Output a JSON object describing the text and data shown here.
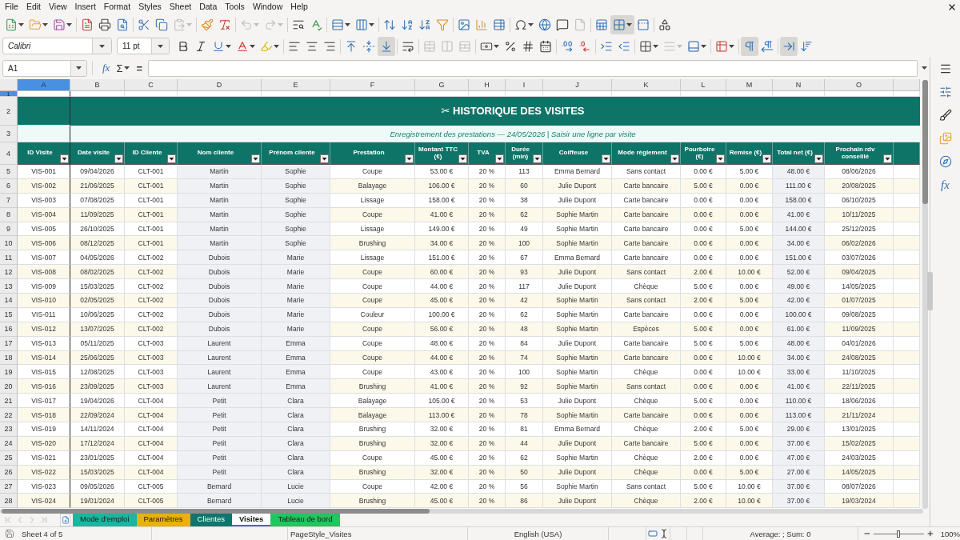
{
  "menu": [
    "File",
    "Edit",
    "View",
    "Insert",
    "Format",
    "Styles",
    "Sheet",
    "Data",
    "Tools",
    "Window",
    "Help"
  ],
  "toolbars": {
    "standard": [
      {
        "dropdown": true,
        "pressed": false,
        "disabled": false
      },
      {
        "dropdown": true,
        "pressed": false,
        "disabled": false
      },
      {
        "dropdown": true,
        "pressed": false,
        "disabled": false
      },
      {
        "dropdown": false,
        "pressed": false,
        "disabled": false
      },
      {
        "dropdown": false,
        "pressed": false,
        "disabled": false
      },
      {
        "dropdown": false,
        "pressed": false,
        "disabled": false
      },
      {
        "dropdown": false,
        "pressed": false,
        "disabled": false
      },
      {
        "dropdown": false,
        "pressed": false,
        "disabled": false
      },
      {
        "dropdown": true,
        "pressed": false,
        "disabled": true
      },
      {
        "dropdown": false,
        "pressed": false,
        "disabled": false
      },
      {
        "dropdown": false,
        "pressed": false,
        "disabled": false
      },
      {
        "dropdown": true,
        "pressed": false,
        "disabled": true
      },
      {
        "dropdown": true,
        "pressed": false,
        "disabled": true
      },
      {
        "dropdown": false,
        "pressed": false,
        "disabled": false
      },
      {
        "dropdown": false,
        "pressed": false,
        "disabled": false
      },
      {
        "dropdown": true,
        "pressed": false,
        "disabled": false
      },
      {
        "dropdown": true,
        "pressed": false,
        "disabled": false
      },
      {
        "dropdown": false,
        "pressed": false,
        "disabled": false
      },
      {
        "dropdown": false,
        "pressed": false,
        "disabled": false
      },
      {
        "dropdown": false,
        "pressed": false,
        "disabled": false
      },
      {
        "dropdown": false,
        "pressed": false,
        "disabled": false
      },
      {
        "dropdown": false,
        "pressed": false,
        "disabled": false
      },
      {
        "dropdown": false,
        "pressed": false,
        "disabled": false
      },
      {
        "dropdown": false,
        "pressed": false,
        "disabled": false
      },
      {
        "dropdown": true,
        "pressed": false,
        "disabled": false
      },
      {
        "dropdown": false,
        "pressed": false,
        "disabled": false
      },
      {
        "dropdown": false,
        "pressed": false,
        "disabled": false
      },
      {
        "dropdown": false,
        "pressed": false,
        "disabled": true
      },
      {
        "dropdown": false,
        "pressed": false,
        "disabled": false
      },
      {
        "dropdown": true,
        "pressed": true,
        "disabled": false
      },
      {
        "dropdown": false,
        "pressed": false,
        "disabled": false
      },
      {
        "dropdown": false,
        "pressed": false,
        "disabled": false
      }
    ],
    "formatting": [
      {
        "dropdown": false,
        "pressed": false,
        "disabled": false
      },
      {
        "dropdown": false,
        "pressed": false,
        "disabled": false
      },
      {
        "dropdown": true,
        "pressed": false,
        "disabled": false
      },
      {
        "dropdown": true,
        "pressed": false,
        "disabled": false
      },
      {
        "dropdown": true,
        "pressed": false,
        "disabled": false
      },
      {
        "dropdown": false,
        "pressed": false,
        "disabled": false
      },
      {
        "dropdown": false,
        "pressed": false,
        "disabled": false
      },
      {
        "dropdown": false,
        "pressed": false,
        "disabled": false
      },
      {
        "dropdown": false,
        "pressed": false,
        "disabled": false
      },
      {
        "dropdown": false,
        "pressed": false,
        "disabled": false
      },
      {
        "dropdown": false,
        "pressed": true,
        "disabled": false
      },
      {
        "dropdown": false,
        "pressed": false,
        "disabled": false
      },
      {
        "dropdown": false,
        "pressed": false,
        "disabled": true
      },
      {
        "dropdown": false,
        "pressed": false,
        "disabled": true
      },
      {
        "dropdown": false,
        "pressed": false,
        "disabled": true
      },
      {
        "dropdown": true,
        "pressed": false,
        "disabled": false
      },
      {
        "dropdown": false,
        "pressed": false,
        "disabled": false
      },
      {
        "dropdown": false,
        "pressed": false,
        "disabled": false
      },
      {
        "dropdown": false,
        "pressed": false,
        "disabled": false
      },
      {
        "dropdown": false,
        "pressed": false,
        "disabled": false
      },
      {
        "dropdown": false,
        "pressed": false,
        "disabled": false
      },
      {
        "dropdown": false,
        "pressed": false,
        "disabled": false
      },
      {
        "dropdown": false,
        "pressed": false,
        "disabled": false
      },
      {
        "dropdown": true,
        "pressed": false,
        "disabled": false
      },
      {
        "dropdown": true,
        "pressed": false,
        "disabled": true
      },
      {
        "dropdown": true,
        "pressed": false,
        "disabled": false
      },
      {
        "dropdown": true,
        "pressed": false,
        "disabled": false
      },
      {
        "dropdown": false,
        "pressed": true,
        "disabled": false
      },
      {
        "dropdown": false,
        "pressed": false,
        "disabled": false
      },
      {
        "dropdown": false,
        "pressed": true,
        "disabled": false
      },
      {
        "dropdown": false,
        "pressed": false,
        "disabled": false
      }
    ]
  },
  "font": {
    "name": "Calibri",
    "size": "11 pt"
  },
  "formula_bar": {
    "name_box": "A1",
    "function_wizard": "fx",
    "sum": "Σ",
    "equals": "="
  },
  "sidebar": {
    "functions": "fx"
  },
  "columns": [
    {
      "label": "A",
      "selected": true
    },
    {
      "label": "B",
      "selected": false
    },
    {
      "label": "C",
      "selected": false
    },
    {
      "label": "D",
      "selected": false
    },
    {
      "label": "E",
      "selected": false
    },
    {
      "label": "F",
      "selected": false
    },
    {
      "label": "G",
      "selected": false
    },
    {
      "label": "H",
      "selected": false
    },
    {
      "label": "I",
      "selected": false
    },
    {
      "label": "J",
      "selected": false
    },
    {
      "label": "K",
      "selected": false
    },
    {
      "label": "L",
      "selected": false
    },
    {
      "label": "M",
      "selected": false
    },
    {
      "label": "N",
      "selected": false
    },
    {
      "label": "O",
      "selected": false
    }
  ],
  "rows": [
    {
      "kind": "blank",
      "number": "1",
      "selected": true
    },
    {
      "kind": "title",
      "number": "2",
      "selected": false,
      "text": "✂ HISTORIQUE DES VISITES"
    },
    {
      "kind": "subtitle",
      "number": "3",
      "selected": false,
      "text": "Enregistrement des prestations — 24/05/2026 | Saisir une ligne par visite"
    },
    {
      "kind": "header",
      "number": "4",
      "selected": false,
      "cells": [
        {
          "label": "ID Visite",
          "kind": "input"
        },
        {
          "label": "Date visite",
          "kind": "input"
        },
        {
          "label": "ID Cliente",
          "kind": "input"
        },
        {
          "label": "Nom cliente",
          "kind": "computed"
        },
        {
          "label": "Prénom cliente",
          "kind": "computed"
        },
        {
          "label": "Prestation",
          "kind": "input"
        },
        {
          "label": "Montant TTC (€)",
          "kind": "input"
        },
        {
          "label": "TVA",
          "kind": "input"
        },
        {
          "label": "Durée (min)",
          "kind": "input"
        },
        {
          "label": "Coiffeuse",
          "kind": "input"
        },
        {
          "label": "Mode règlement",
          "kind": "input"
        },
        {
          "label": "Pourboire (€)",
          "kind": "input"
        },
        {
          "label": "Remise (€)",
          "kind": "input"
        },
        {
          "label": "Total net (€)",
          "kind": "computed"
        },
        {
          "label": "Prochain rdv conseillé",
          "kind": "input"
        }
      ]
    },
    {
      "kind": "data",
      "number": "5",
      "selected": false,
      "cells": [
        "VIS-001",
        "09/04/2026",
        "CLT-001",
        "Martin",
        "Sophie",
        "Coupe",
        "53.00 €",
        "20 %",
        "113",
        "Emma Bernard",
        "Sans contact",
        "0.00 €",
        "5.00 €",
        "48.00 €",
        "08/06/2026"
      ]
    },
    {
      "kind": "data",
      "number": "6",
      "selected": false,
      "cells": [
        "VIS-002",
        "21/06/2025",
        "CLT-001",
        "Martin",
        "Sophie",
        "Balayage",
        "106.00 €",
        "20 %",
        "60",
        "Julie Dupont",
        "Carte bancaire",
        "5.00 €",
        "0.00 €",
        "111.00 €",
        "20/08/2025"
      ]
    },
    {
      "kind": "data",
      "number": "7",
      "selected": false,
      "cells": [
        "VIS-003",
        "07/08/2025",
        "CLT-001",
        "Martin",
        "Sophie",
        "Lissage",
        "158.00 €",
        "20 %",
        "38",
        "Julie Dupont",
        "Carte bancaire",
        "0.00 €",
        "0.00 €",
        "158.00 €",
        "06/10/2025"
      ]
    },
    {
      "kind": "data",
      "number": "8",
      "selected": false,
      "cells": [
        "VIS-004",
        "11/09/2025",
        "CLT-001",
        "Martin",
        "Sophie",
        "Coupe",
        "41.00 €",
        "20 %",
        "62",
        "Sophie Martin",
        "Carte bancaire",
        "0.00 €",
        "0.00 €",
        "41.00 €",
        "10/11/2025"
      ]
    },
    {
      "kind": "data",
      "number": "9",
      "selected": false,
      "cells": [
        "VIS-005",
        "26/10/2025",
        "CLT-001",
        "Martin",
        "Sophie",
        "Lissage",
        "149.00 €",
        "20 %",
        "49",
        "Sophie Martin",
        "Carte bancaire",
        "0.00 €",
        "5.00 €",
        "144.00 €",
        "25/12/2025"
      ]
    },
    {
      "kind": "data",
      "number": "10",
      "selected": false,
      "cells": [
        "VIS-006",
        "08/12/2025",
        "CLT-001",
        "Martin",
        "Sophie",
        "Brushing",
        "34.00 €",
        "20 %",
        "100",
        "Sophie Martin",
        "Carte bancaire",
        "0.00 €",
        "0.00 €",
        "34.00 €",
        "06/02/2026"
      ]
    },
    {
      "kind": "data",
      "number": "11",
      "selected": false,
      "cells": [
        "VIS-007",
        "04/05/2026",
        "CLT-002",
        "Dubois",
        "Marie",
        "Lissage",
        "151.00 €",
        "20 %",
        "67",
        "Emma Bernard",
        "Carte bancaire",
        "0.00 €",
        "0.00 €",
        "151.00 €",
        "03/07/2026"
      ]
    },
    {
      "kind": "data",
      "number": "12",
      "selected": false,
      "cells": [
        "VIS-008",
        "08/02/2025",
        "CLT-002",
        "Dubois",
        "Marie",
        "Coupe",
        "60.00 €",
        "20 %",
        "93",
        "Julie Dupont",
        "Sans contact",
        "2.00 €",
        "10.00 €",
        "52.00 €",
        "09/04/2025"
      ]
    },
    {
      "kind": "data",
      "number": "13",
      "selected": false,
      "cells": [
        "VIS-009",
        "15/03/2025",
        "CLT-002",
        "Dubois",
        "Marie",
        "Coupe",
        "44.00 €",
        "20 %",
        "117",
        "Julie Dupont",
        "Chèque",
        "5.00 €",
        "0.00 €",
        "49.00 €",
        "14/05/2025"
      ]
    },
    {
      "kind": "data",
      "number": "14",
      "selected": false,
      "cells": [
        "VIS-010",
        "02/05/2025",
        "CLT-002",
        "Dubois",
        "Marie",
        "Coupe",
        "45.00 €",
        "20 %",
        "42",
        "Sophie Martin",
        "Sans contact",
        "2.00 €",
        "5.00 €",
        "42.00 €",
        "01/07/2025"
      ]
    },
    {
      "kind": "data",
      "number": "15",
      "selected": false,
      "cells": [
        "VIS-011",
        "10/06/2025",
        "CLT-002",
        "Dubois",
        "Marie",
        "Couleur",
        "100.00 €",
        "20 %",
        "62",
        "Sophie Martin",
        "Carte bancaire",
        "0.00 €",
        "0.00 €",
        "100.00 €",
        "09/08/2025"
      ]
    },
    {
      "kind": "data",
      "number": "16",
      "selected": false,
      "cells": [
        "VIS-012",
        "13/07/2025",
        "CLT-002",
        "Dubois",
        "Marie",
        "Coupe",
        "56.00 €",
        "20 %",
        "48",
        "Sophie Martin",
        "Espèces",
        "5.00 €",
        "0.00 €",
        "61.00 €",
        "11/09/2025"
      ]
    },
    {
      "kind": "data",
      "number": "17",
      "selected": false,
      "cells": [
        "VIS-013",
        "05/11/2025",
        "CLT-003",
        "Laurent",
        "Emma",
        "Coupe",
        "48.00 €",
        "20 %",
        "84",
        "Julie Dupont",
        "Carte bancaire",
        "5.00 €",
        "5.00 €",
        "48.00 €",
        "04/01/2026"
      ]
    },
    {
      "kind": "data",
      "number": "18",
      "selected": false,
      "cells": [
        "VIS-014",
        "25/06/2025",
        "CLT-003",
        "Laurent",
        "Emma",
        "Coupe",
        "44.00 €",
        "20 %",
        "74",
        "Sophie Martin",
        "Carte bancaire",
        "0.00 €",
        "10.00 €",
        "34.00 €",
        "24/08/2025"
      ]
    },
    {
      "kind": "data",
      "number": "19",
      "selected": false,
      "cells": [
        "VIS-015",
        "12/08/2025",
        "CLT-003",
        "Laurent",
        "Emma",
        "Coupe",
        "43.00 €",
        "20 %",
        "100",
        "Sophie Martin",
        "Chèque",
        "0.00 €",
        "10.00 €",
        "33.00 €",
        "11/10/2025"
      ]
    },
    {
      "kind": "data",
      "number": "20",
      "selected": false,
      "cells": [
        "VIS-016",
        "23/09/2025",
        "CLT-003",
        "Laurent",
        "Emma",
        "Brushing",
        "41.00 €",
        "20 %",
        "92",
        "Sophie Martin",
        "Sans contact",
        "0.00 €",
        "0.00 €",
        "41.00 €",
        "22/11/2025"
      ]
    },
    {
      "kind": "data",
      "number": "21",
      "selected": false,
      "cells": [
        "VIS-017",
        "19/04/2026",
        "CLT-004",
        "Petit",
        "Clara",
        "Balayage",
        "105.00 €",
        "20 %",
        "53",
        "Julie Dupont",
        "Chèque",
        "5.00 €",
        "0.00 €",
        "110.00 €",
        "18/06/2026"
      ]
    },
    {
      "kind": "data",
      "number": "22",
      "selected": false,
      "cells": [
        "VIS-018",
        "22/09/2024",
        "CLT-004",
        "Petit",
        "Clara",
        "Balayage",
        "113.00 €",
        "20 %",
        "78",
        "Sophie Martin",
        "Carte bancaire",
        "0.00 €",
        "0.00 €",
        "113.00 €",
        "21/11/2024"
      ]
    },
    {
      "kind": "data",
      "number": "23",
      "selected": false,
      "cells": [
        "VIS-019",
        "14/11/2024",
        "CLT-004",
        "Petit",
        "Clara",
        "Brushing",
        "32.00 €",
        "20 %",
        "81",
        "Emma Bernard",
        "Chèque",
        "2.00 €",
        "5.00 €",
        "29.00 €",
        "13/01/2025"
      ]
    },
    {
      "kind": "data",
      "number": "24",
      "selected": false,
      "cells": [
        "VIS-020",
        "17/12/2024",
        "CLT-004",
        "Petit",
        "Clara",
        "Brushing",
        "32.00 €",
        "20 %",
        "44",
        "Julie Dupont",
        "Carte bancaire",
        "5.00 €",
        "0.00 €",
        "37.00 €",
        "15/02/2025"
      ]
    },
    {
      "kind": "data",
      "number": "25",
      "selected": false,
      "cells": [
        "VIS-021",
        "23/01/2025",
        "CLT-004",
        "Petit",
        "Clara",
        "Coupe",
        "45.00 €",
        "20 %",
        "62",
        "Sophie Martin",
        "Chèque",
        "2.00 €",
        "0.00 €",
        "47.00 €",
        "24/03/2025"
      ]
    },
    {
      "kind": "data",
      "number": "26",
      "selected": false,
      "cells": [
        "VIS-022",
        "15/03/2025",
        "CLT-004",
        "Petit",
        "Clara",
        "Brushing",
        "32.00 €",
        "20 %",
        "50",
        "Julie Dupont",
        "Chèque",
        "0.00 €",
        "5.00 €",
        "27.00 €",
        "14/05/2025"
      ]
    },
    {
      "kind": "data",
      "number": "27",
      "selected": false,
      "cells": [
        "VIS-023",
        "09/05/2026",
        "CLT-005",
        "Bernard",
        "Lucie",
        "Coupe",
        "42.00 €",
        "20 %",
        "56",
        "Sophie Martin",
        "Sans contact",
        "5.00 €",
        "10.00 €",
        "37.00 €",
        "08/07/2026"
      ]
    },
    {
      "kind": "data",
      "number": "28",
      "selected": false,
      "cells": [
        "VIS-024",
        "19/01/2024",
        "CLT-005",
        "Bernard",
        "Lucie",
        "Brushing",
        "45.00 €",
        "20 %",
        "86",
        "Julie Dupont",
        "Chèque",
        "2.00 €",
        "10.00 €",
        "37.00 €",
        "19/03/2024"
      ]
    }
  ],
  "sheet_tabs": [
    {
      "label": "Mode d'emploi",
      "color": "#1cb5a0",
      "selected": false
    },
    {
      "label": "Paramètres",
      "color": "#e9b10a",
      "selected": false
    },
    {
      "label": "Clientes",
      "color": "#0f766e",
      "selected": false
    },
    {
      "label": "Visites",
      "color": "#5b5bd6",
      "selected": true
    },
    {
      "label": "Tableau de bord",
      "color": "#22c55e",
      "selected": false
    }
  ],
  "status_bar": {
    "sheet_position": "Sheet 4 of 5",
    "page_style": "PageStyle_Visites",
    "language": "English (USA)",
    "selection_summary": "Average: ; Sum: 0",
    "zoom": {
      "level": 0.5,
      "label": "100%"
    }
  }
}
